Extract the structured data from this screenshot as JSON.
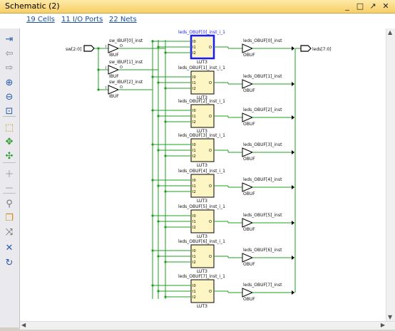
{
  "window": {
    "title": "Schematic (2)",
    "controls": [
      "_",
      "□",
      "↗",
      "✕"
    ]
  },
  "links": {
    "cells": "19 Cells",
    "ports": "11 I/O Ports",
    "nets": "22 Nets"
  },
  "toolbar": {
    "icons": [
      "fit-in-icon",
      "back-arrow-icon",
      "forward-arrow-icon",
      "zoom-in-icon",
      "zoom-out-icon",
      "zoom-fit-icon",
      "select-icon",
      "expand-icon",
      "collapse-icon",
      "add-icon",
      "remove-icon",
      "search-icon",
      "copy-icon",
      "route-icon",
      "close-icon",
      "refresh-icon"
    ]
  },
  "schematic": {
    "input_port": "sw[2:0]",
    "output_port": "leds[7:0]",
    "ibufs": [
      {
        "name": "sw_IBUF[0]_inst",
        "type": "IBUF",
        "pin_i": "I",
        "pin_o": "O"
      },
      {
        "name": "sw_IBUF[1]_inst",
        "type": "IBUF",
        "pin_i": "I",
        "pin_o": "O"
      },
      {
        "name": "sw_IBUF[2]_inst",
        "type": "IBUF",
        "pin_i": "I",
        "pin_o": "O"
      }
    ],
    "luts": [
      {
        "name": "leds_OBUF[0]_inst_i_1",
        "type": "LUT3",
        "selected": true
      },
      {
        "name": "leds_OBUF[1]_inst_i_1",
        "type": "LUT3"
      },
      {
        "name": "leds_OBUF[2]_inst_i_1",
        "type": "LUT3"
      },
      {
        "name": "leds_OBUF[3]_inst_i_1",
        "type": "LUT3"
      },
      {
        "name": "leds_OBUF[4]_inst_i_1",
        "type": "LUT3"
      },
      {
        "name": "leds_OBUF[5]_inst_i_1",
        "type": "LUT3"
      },
      {
        "name": "leds_OBUF[6]_inst_i_1",
        "type": "LUT3"
      },
      {
        "name": "leds_OBUF[7]_inst_i_1",
        "type": "LUT3"
      }
    ],
    "obufs": [
      {
        "name": "leds_OBUF[0]_inst",
        "type": "OBUF"
      },
      {
        "name": "leds_OBUF[1]_inst",
        "type": "OBUF"
      },
      {
        "name": "leds_OBUF[2]_inst",
        "type": "OBUF"
      },
      {
        "name": "leds_OBUF[3]_inst",
        "type": "OBUF"
      },
      {
        "name": "leds_OBUF[4]_inst",
        "type": "OBUF"
      },
      {
        "name": "leds_OBUF[5]_inst",
        "type": "OBUF"
      },
      {
        "name": "leds_OBUF[6]_inst",
        "type": "OBUF"
      },
      {
        "name": "leds_OBUF[7]_inst",
        "type": "OBUF"
      }
    ],
    "lut_pins": [
      "I0",
      "I1",
      "I2",
      "O"
    ],
    "colors": {
      "wire": "#1f9f1f",
      "cell_fill": "#fdf6c4",
      "selected": "#1a1aff",
      "label": "#111",
      "selected_label": "#1a1aff"
    }
  }
}
